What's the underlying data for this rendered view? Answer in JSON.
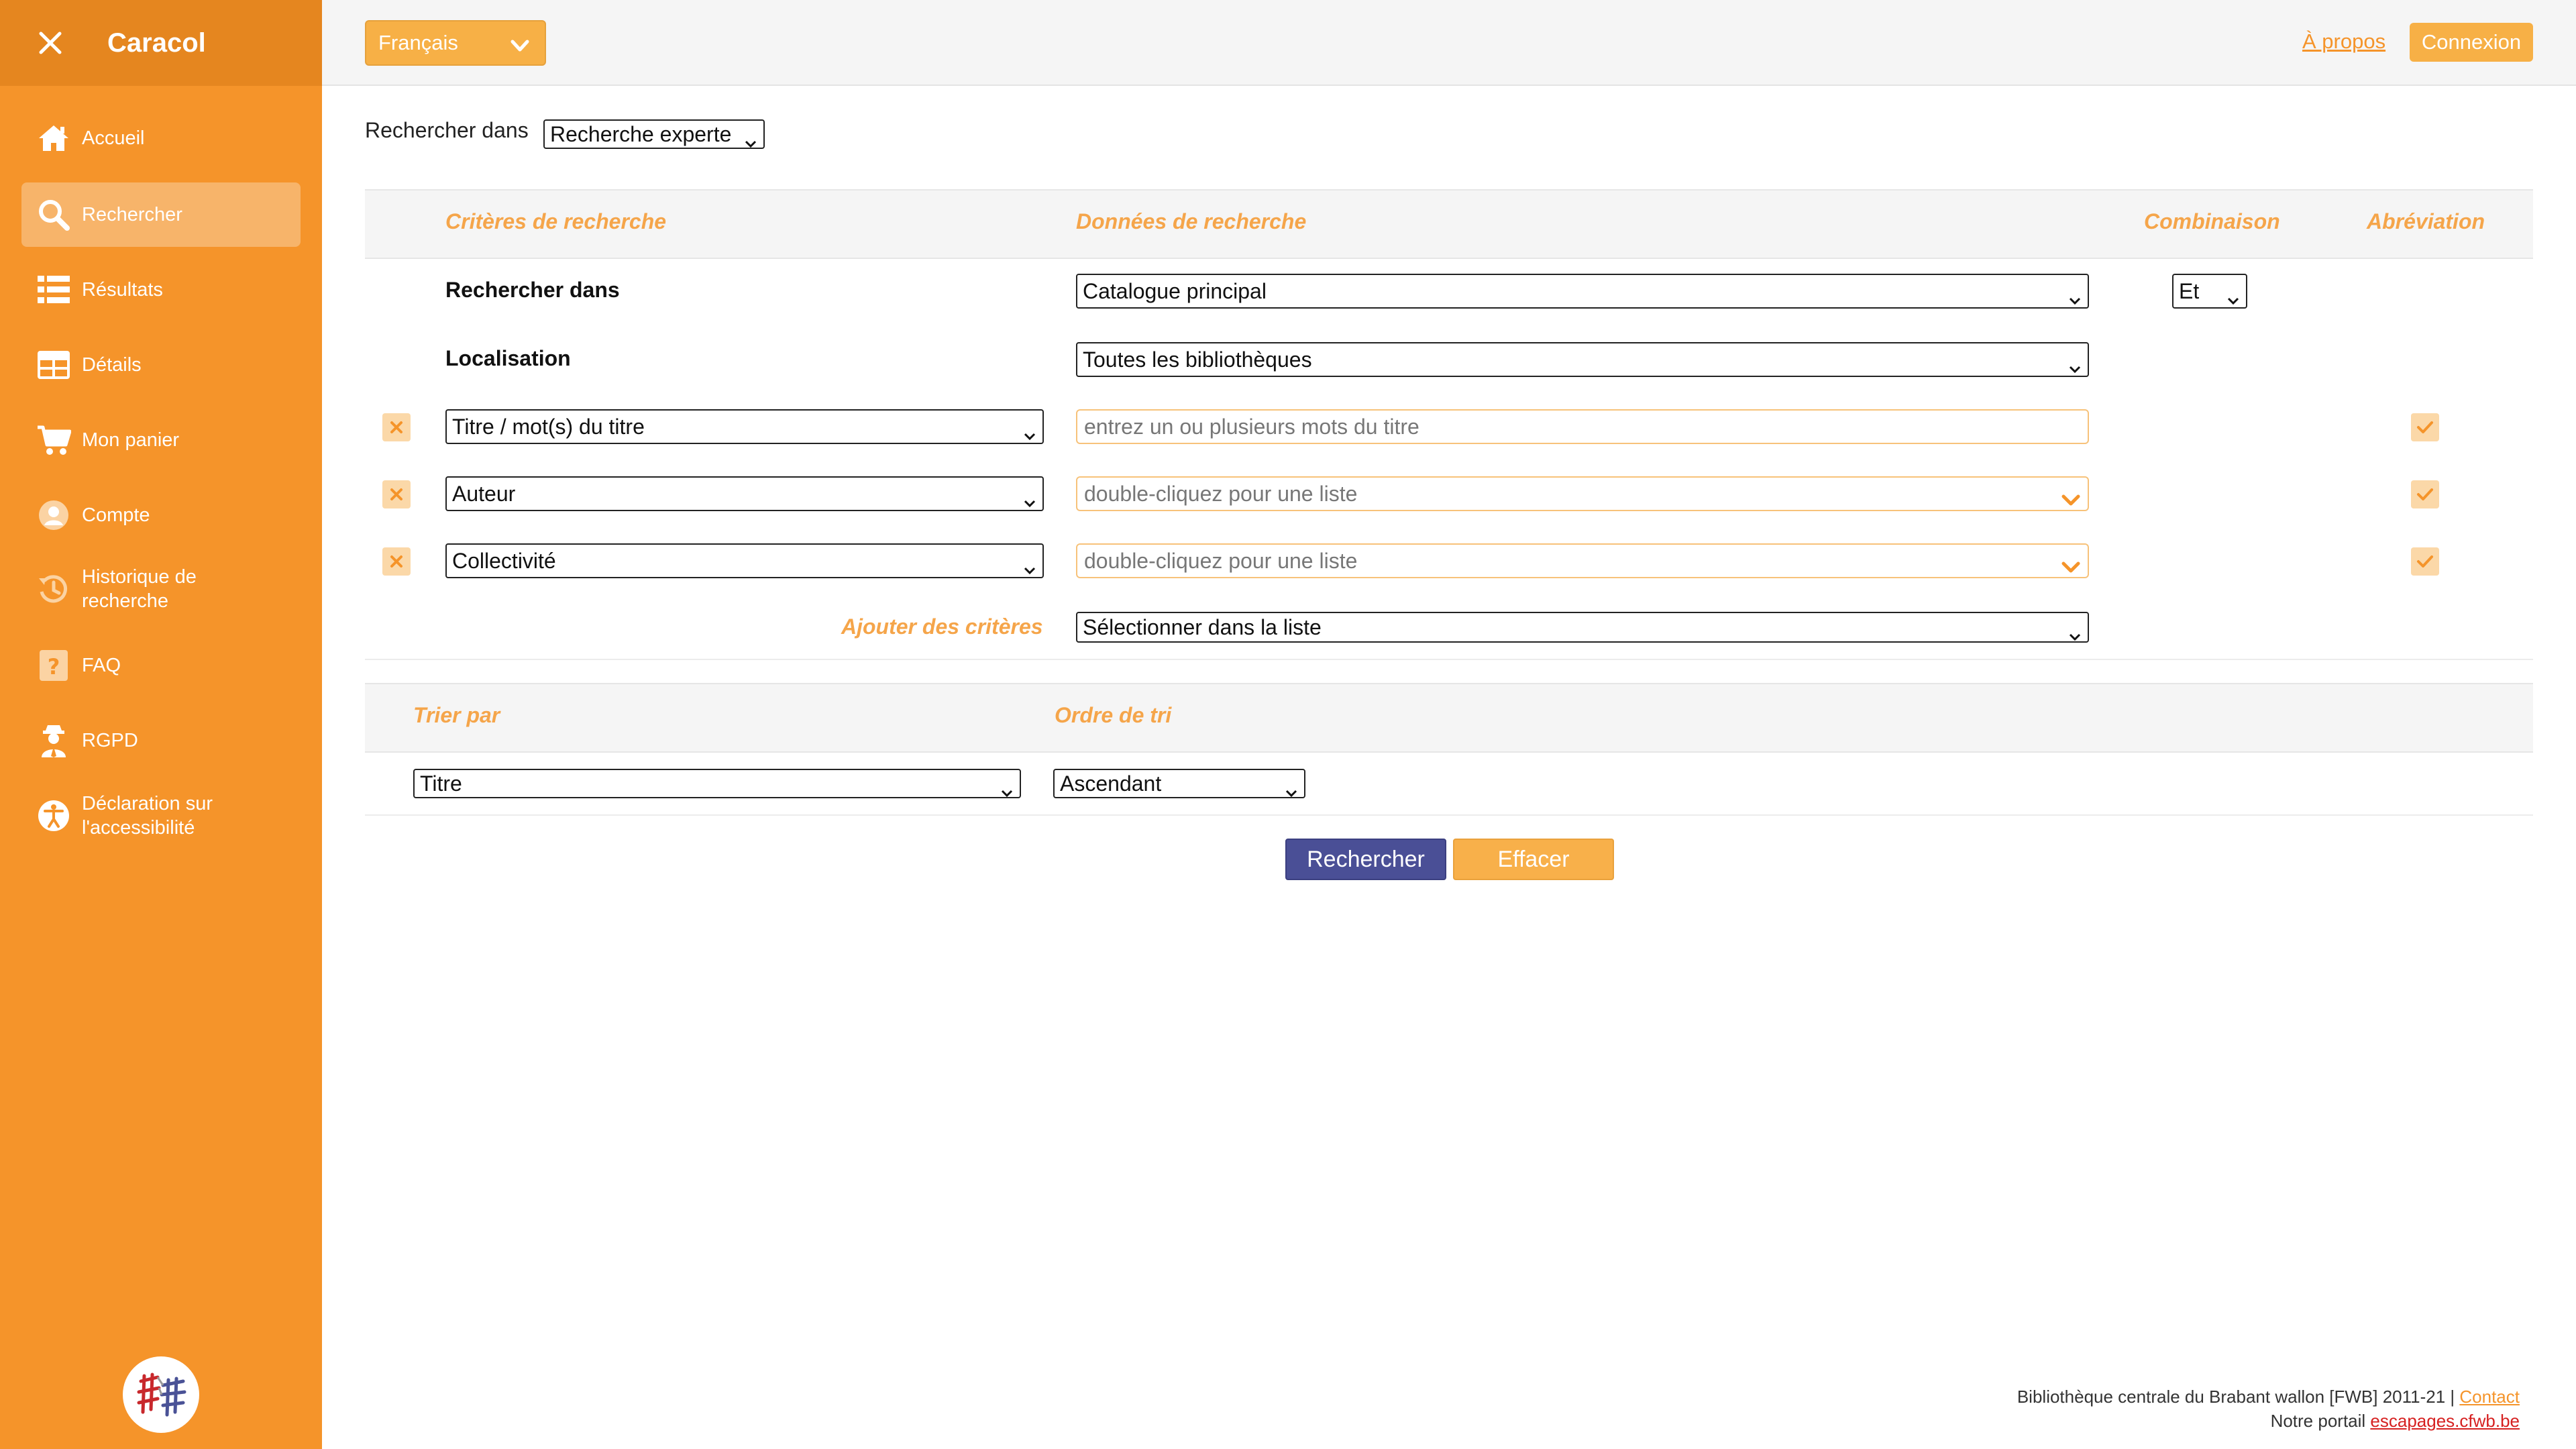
{
  "app": {
    "name": "Caracol"
  },
  "colors": {
    "brand": "#f5942a",
    "accent": "#f7b046",
    "primary_button": "#4a4f96"
  },
  "sidebar": {
    "close_icon": "close-icon",
    "items": [
      {
        "label": "Accueil",
        "icon": "home-icon",
        "active": false
      },
      {
        "label": "Rechercher",
        "icon": "search-icon",
        "active": true
      },
      {
        "label": "Résultats",
        "icon": "list-icon",
        "active": false
      },
      {
        "label": "Détails",
        "icon": "details-grid-icon",
        "active": false
      },
      {
        "label": "Mon panier",
        "icon": "cart-icon",
        "active": false
      },
      {
        "label": "Compte",
        "icon": "user-icon",
        "active": false
      },
      {
        "label": "Historique de recherche",
        "icon": "history-icon",
        "active": false
      },
      {
        "label": "FAQ",
        "icon": "question-icon",
        "active": false
      },
      {
        "label": "RGPD",
        "icon": "privacy-agent-icon",
        "active": false
      },
      {
        "label": "Déclaration sur l'accessibilité",
        "icon": "accessibility-icon",
        "active": false
      }
    ]
  },
  "topbar": {
    "language": "Français",
    "about": "À propos",
    "login": "Connexion"
  },
  "search": {
    "search_in_label": "Rechercher dans",
    "mode": "Recherche experte",
    "headers": {
      "criteria": "Critères de recherche",
      "data": "Données de recherche",
      "combination": "Combinaison",
      "abbreviation": "Abréviation"
    },
    "fixed_rows": [
      {
        "label": "Rechercher dans",
        "value": "Catalogue principal",
        "combination": "Et"
      },
      {
        "label": "Localisation",
        "value": "Toutes les bibliothèques"
      }
    ],
    "criteria_rows": [
      {
        "field": "Titre / mot(s) du titre",
        "placeholder": "entrez un ou plusieurs mots du titre",
        "abbreviation": true
      },
      {
        "field": "Auteur",
        "placeholder": "double-cliquez pour une liste",
        "abbreviation": true
      },
      {
        "field": "Collectivité",
        "placeholder": "double-cliquez pour une liste",
        "abbreviation": true
      }
    ],
    "add_criteria": {
      "label": "Ajouter des critères",
      "value": "Sélectionner dans la liste"
    }
  },
  "sort": {
    "sort_by_label": "Trier par",
    "order_label": "Ordre de tri",
    "sort_by": "Titre",
    "order": "Ascendant"
  },
  "actions": {
    "search": "Rechercher",
    "clear": "Effacer"
  },
  "footer": {
    "copyright": "Bibliothèque centrale du Brabant wallon [FWB] 2011-21 | ",
    "contact": "Contact",
    "portal_label": "Notre portail ",
    "portal_link": "escapages.cfwb.be"
  }
}
